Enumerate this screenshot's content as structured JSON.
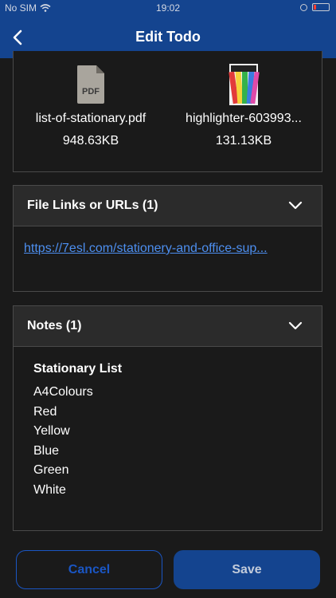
{
  "status_bar": {
    "carrier": "No SIM",
    "time": "19:02"
  },
  "nav": {
    "title": "Edit Todo",
    "back_icon": "chevron-left-icon"
  },
  "attachments": [
    {
      "name": "list-of-stationary.pdf",
      "size": "948.63KB",
      "icon": "pdf-file-icon"
    },
    {
      "name": "highlighter-603993...",
      "size": "131.13KB",
      "icon": "image-thumbnail-icon"
    }
  ],
  "links_section": {
    "title": "File Links or URLs (1)",
    "links": [
      "https://7esl.com/stationery-and-office-sup..."
    ]
  },
  "notes_section": {
    "title": "Notes (1)",
    "heading": "Stationary List",
    "lines": [
      "A4Colours",
      "Red",
      "Yellow",
      "Blue",
      "Green",
      "White"
    ]
  },
  "buttons": {
    "cancel": "Cancel",
    "save": "Save"
  },
  "colors": {
    "header_blue": "#14448f",
    "link_blue": "#4d8ff0",
    "background": "#1a1a1a"
  }
}
